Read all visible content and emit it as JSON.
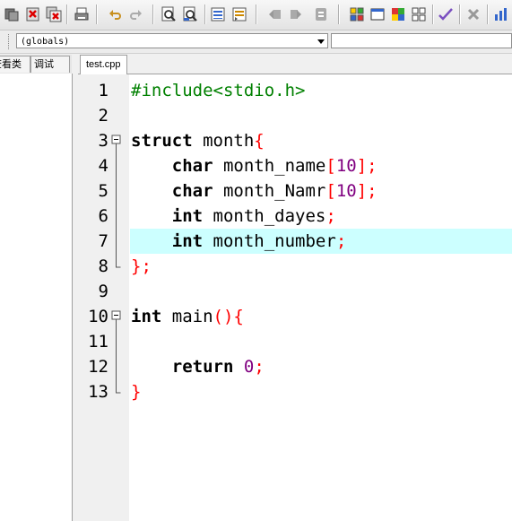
{
  "toolbar": {
    "icons": [
      "new-icon",
      "close-file-icon",
      "close-all-icon",
      "print-icon",
      "undo-icon",
      "redo-icon",
      "find-icon",
      "replace-icon",
      "indent-icon",
      "unindent-icon",
      "bookmark-prev-icon",
      "bookmark-next-icon",
      "bookmark-toggle-icon",
      "grid-icon",
      "window-icon",
      "colors-icon",
      "layout-icon",
      "check-icon",
      "cross-icon",
      "chart-icon"
    ]
  },
  "scope_combo": {
    "value": "(globals)"
  },
  "left_panel": {
    "tab_class_view": "查看类",
    "tab_debug": "调试"
  },
  "editor": {
    "tab_label": "test.cpp",
    "highlight_line": 7,
    "highlight_color": "#ccffff",
    "lines": [
      {
        "num": "1",
        "segments": [
          {
            "t": "#include<stdio.h>",
            "c": "pp"
          }
        ]
      },
      {
        "num": "2",
        "segments": []
      },
      {
        "num": "3",
        "fold": "open",
        "segments": [
          {
            "t": "struct",
            "c": "kw"
          },
          {
            "t": " month",
            "c": ""
          },
          {
            "t": "{",
            "c": "sym"
          }
        ]
      },
      {
        "num": "4",
        "segments": [
          {
            "t": "    ",
            "c": ""
          },
          {
            "t": "char",
            "c": "kw"
          },
          {
            "t": " month_name",
            "c": ""
          },
          {
            "t": "[",
            "c": "sym"
          },
          {
            "t": "10",
            "c": "num"
          },
          {
            "t": "];",
            "c": "sym"
          }
        ]
      },
      {
        "num": "5",
        "segments": [
          {
            "t": "    ",
            "c": ""
          },
          {
            "t": "char",
            "c": "kw"
          },
          {
            "t": " month_Namr",
            "c": ""
          },
          {
            "t": "[",
            "c": "sym"
          },
          {
            "t": "10",
            "c": "num"
          },
          {
            "t": "];",
            "c": "sym"
          }
        ]
      },
      {
        "num": "6",
        "segments": [
          {
            "t": "    ",
            "c": ""
          },
          {
            "t": "int",
            "c": "kw"
          },
          {
            "t": " month_dayes",
            "c": ""
          },
          {
            "t": ";",
            "c": "sym"
          }
        ]
      },
      {
        "num": "7",
        "segments": [
          {
            "t": "    ",
            "c": ""
          },
          {
            "t": "int",
            "c": "kw"
          },
          {
            "t": " month_number",
            "c": ""
          },
          {
            "t": ";",
            "c": "sym"
          }
        ]
      },
      {
        "num": "8",
        "fold": "end",
        "segments": [
          {
            "t": "};",
            "c": "sym"
          }
        ]
      },
      {
        "num": "9",
        "segments": []
      },
      {
        "num": "10",
        "fold": "open",
        "segments": [
          {
            "t": "int",
            "c": "kw"
          },
          {
            "t": " main",
            "c": ""
          },
          {
            "t": "(){",
            "c": "sym"
          }
        ]
      },
      {
        "num": "11",
        "segments": []
      },
      {
        "num": "12",
        "segments": [
          {
            "t": "    ",
            "c": ""
          },
          {
            "t": "return",
            "c": "kw"
          },
          {
            "t": " ",
            "c": ""
          },
          {
            "t": "0",
            "c": "num"
          },
          {
            "t": ";",
            "c": "sym"
          }
        ]
      },
      {
        "num": "13",
        "fold": "end",
        "segments": [
          {
            "t": "}",
            "c": "sym"
          }
        ]
      }
    ]
  }
}
